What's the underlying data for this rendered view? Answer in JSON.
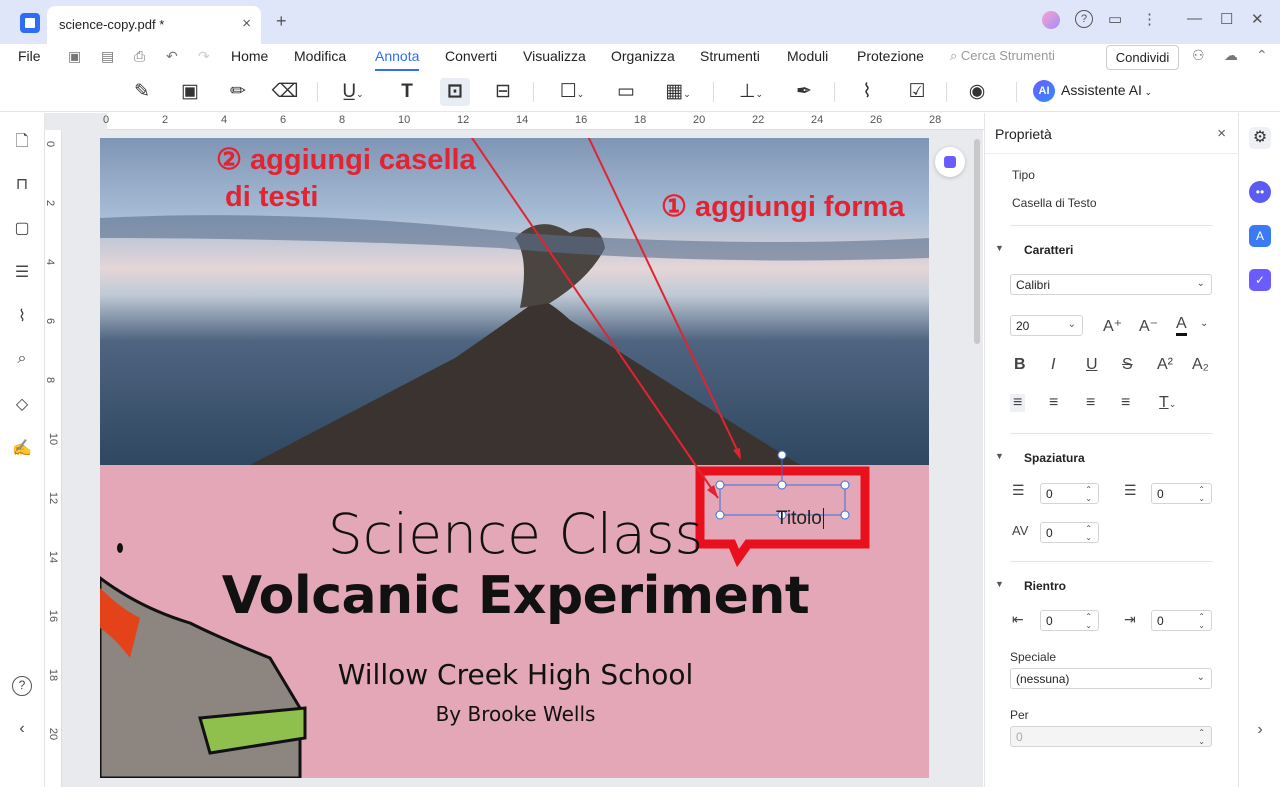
{
  "app": {
    "tab_title": "science-copy.pdf *",
    "tab_close": "×",
    "new_tab": "+"
  },
  "window": {
    "help": "?",
    "comment": "▭",
    "more": "⋮",
    "minimize": "—",
    "maximize": "☐",
    "close": "✕"
  },
  "menu": {
    "file": "File",
    "items": [
      "Home",
      "Modifica",
      "Annota",
      "Converti",
      "Visualizza",
      "Organizza",
      "Strumenti",
      "Moduli",
      "Protezione"
    ],
    "active": "Annota",
    "search_placeholder": "Cerca Strumenti",
    "share": "Condividi"
  },
  "toolbar": {
    "ai_label": "Assistente AI",
    "ai_badge": "AI",
    "icons": [
      "highlight-icon",
      "sticky-note-icon",
      "pencil-icon",
      "eraser-icon",
      "underline-icon",
      "text-icon",
      "text-box-icon",
      "text-callout-icon",
      "shape-icon",
      "note-icon",
      "measure-icon",
      "stamp-icon",
      "signature-icon",
      "attachment-icon",
      "form-icon",
      "eye-icon"
    ]
  },
  "ruler": {
    "h": [
      "0",
      "2",
      "4",
      "6",
      "8",
      "10",
      "12",
      "14",
      "16",
      "18",
      "20",
      "22",
      "24",
      "26",
      "28"
    ],
    "v": [
      "0",
      "2",
      "4",
      "6",
      "8",
      "10",
      "12",
      "14",
      "16",
      "18",
      "20"
    ]
  },
  "slide": {
    "annotation_1": "② aggiungi casella",
    "annotation_1b": "di testi",
    "annotation_2": "① aggiungi forma",
    "textbox": "Titolo",
    "line1": "Science Class",
    "line2": "Volcanic Experiment",
    "line3": "Willow Creek High School",
    "line4": "By Brooke Wells"
  },
  "properties": {
    "title": "Proprietà",
    "close": "×",
    "tipo_label": "Tipo",
    "tipo_value": "Casella di Testo",
    "caratteri": "Caratteri",
    "font": "Calibri",
    "size": "20",
    "spaziatura": "Spaziatura",
    "spacing": [
      "0",
      "0",
      "0"
    ],
    "rientro": "Rientro",
    "indent": [
      "0",
      "0"
    ],
    "speciale": "Speciale",
    "speciale_value": "(nessuna)",
    "per": "Per",
    "per_value": "0"
  },
  "colors": {
    "accent": "#2f6df6",
    "annotation": "#e22332",
    "slide_bg": "#e3a7b8"
  }
}
